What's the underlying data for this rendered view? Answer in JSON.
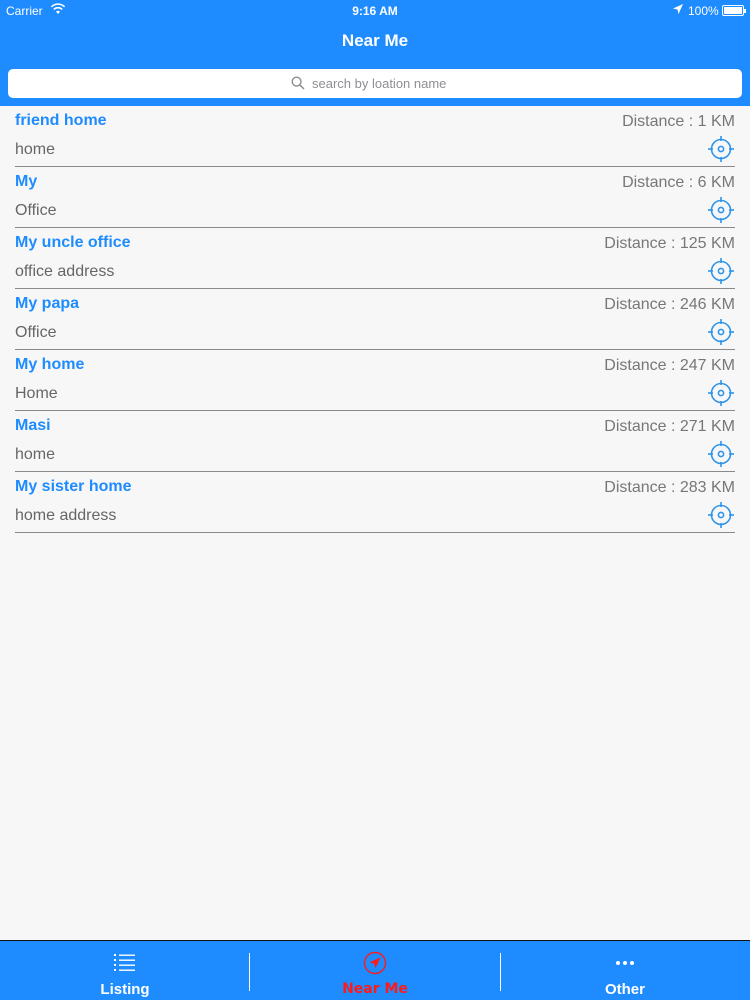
{
  "status_bar": {
    "carrier": "Carrier",
    "time": "9:16 AM",
    "battery": "100%"
  },
  "nav": {
    "title": "Near Me"
  },
  "search": {
    "placeholder": "search by loation name"
  },
  "locations": [
    {
      "name": "friend home",
      "address": "home",
      "distance": "Distance : 1 KM"
    },
    {
      "name": "My",
      "address": "Office",
      "distance": "Distance : 6 KM"
    },
    {
      "name": "My uncle office",
      "address": "office address",
      "distance": "Distance : 125 KM"
    },
    {
      "name": "My papa",
      "address": "Office",
      "distance": "Distance : 246 KM"
    },
    {
      "name": "My home",
      "address": "Home",
      "distance": "Distance : 247 KM"
    },
    {
      "name": "Masi",
      "address": "home",
      "distance": "Distance : 271 KM"
    },
    {
      "name": "My sister home",
      "address": "home address",
      "distance": "Distance : 283 KM"
    }
  ],
  "tabs": [
    {
      "label": "Listing",
      "icon": "list-icon"
    },
    {
      "label": "Near Me",
      "icon": "navigation-arrow-icon",
      "active": true
    },
    {
      "label": "Other",
      "icon": "more-dots-icon"
    }
  ],
  "colors": {
    "primary": "#1e8cff",
    "active_tab": "#ff1a1a"
  }
}
